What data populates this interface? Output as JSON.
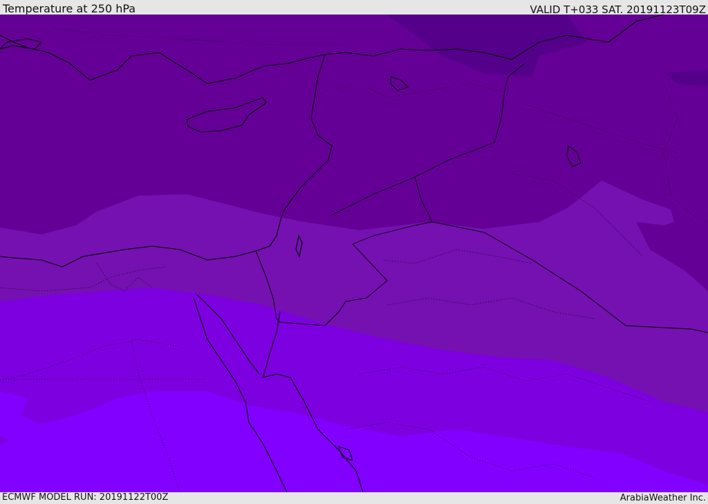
{
  "header": {
    "title": "Temperature at 250 hPa",
    "valid": "VALID T+033 SAT. 20191123T09Z"
  },
  "footer": {
    "model_run": "ECMWF MODEL RUN: 20191122T00Z",
    "credit": "ArabiaWeather Inc."
  },
  "colors": {
    "band_darkest": "#4e0084",
    "band_dark": "#640096",
    "band_mid": "#7411b0",
    "band_light": "#7d00e0",
    "band_lightest": "#8200ff",
    "coastline": "#000000",
    "background": "#e6e6e6"
  }
}
